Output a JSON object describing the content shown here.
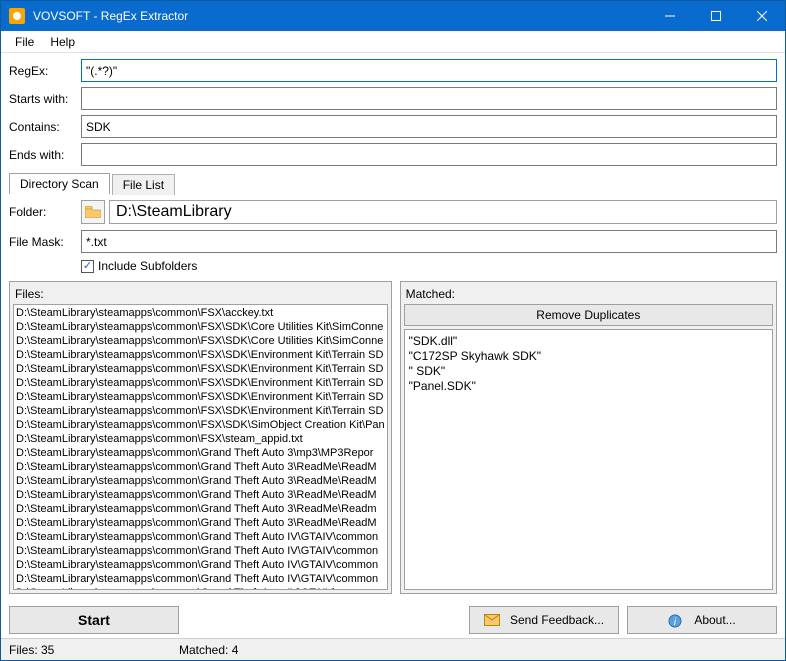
{
  "window": {
    "title": "VOVSOFT - RegEx Extractor"
  },
  "menu": {
    "file": "File",
    "help": "Help"
  },
  "fields": {
    "regex_label": "RegEx:",
    "regex_value": "\"(.*?)\"",
    "startswith_label": "Starts with:",
    "startswith_value": "",
    "contains_label": "Contains:",
    "contains_value": "SDK",
    "endswith_label": "Ends with:",
    "endswith_value": ""
  },
  "tabs": {
    "dir": "Directory Scan",
    "filelist": "File List"
  },
  "dirscan": {
    "folder_label": "Folder:",
    "folder_value": "D:\\SteamLibrary",
    "mask_label": "File Mask:",
    "mask_value": "*.txt",
    "include_sub": "Include Subfolders"
  },
  "panels": {
    "files_label": "Files:",
    "matched_label": "Matched:",
    "remove_dup": "Remove Duplicates"
  },
  "files": [
    "D:\\SteamLibrary\\steamapps\\common\\FSX\\acckey.txt",
    "D:\\SteamLibrary\\steamapps\\common\\FSX\\SDK\\Core Utilities Kit\\SimConne",
    "D:\\SteamLibrary\\steamapps\\common\\FSX\\SDK\\Core Utilities Kit\\SimConne",
    "D:\\SteamLibrary\\steamapps\\common\\FSX\\SDK\\Environment Kit\\Terrain SD",
    "D:\\SteamLibrary\\steamapps\\common\\FSX\\SDK\\Environment Kit\\Terrain SD",
    "D:\\SteamLibrary\\steamapps\\common\\FSX\\SDK\\Environment Kit\\Terrain SD",
    "D:\\SteamLibrary\\steamapps\\common\\FSX\\SDK\\Environment Kit\\Terrain SD",
    "D:\\SteamLibrary\\steamapps\\common\\FSX\\SDK\\Environment Kit\\Terrain SD",
    "D:\\SteamLibrary\\steamapps\\common\\FSX\\SDK\\SimObject Creation Kit\\Pan",
    "D:\\SteamLibrary\\steamapps\\common\\FSX\\steam_appid.txt",
    "D:\\SteamLibrary\\steamapps\\common\\Grand Theft Auto 3\\mp3\\MP3Repor",
    "D:\\SteamLibrary\\steamapps\\common\\Grand Theft Auto 3\\ReadMe\\ReadM",
    "D:\\SteamLibrary\\steamapps\\common\\Grand Theft Auto 3\\ReadMe\\ReadM",
    "D:\\SteamLibrary\\steamapps\\common\\Grand Theft Auto 3\\ReadMe\\ReadM",
    "D:\\SteamLibrary\\steamapps\\common\\Grand Theft Auto 3\\ReadMe\\Readm",
    "D:\\SteamLibrary\\steamapps\\common\\Grand Theft Auto 3\\ReadMe\\ReadM",
    "D:\\SteamLibrary\\steamapps\\common\\Grand Theft Auto IV\\GTAIV\\common",
    "D:\\SteamLibrary\\steamapps\\common\\Grand Theft Auto IV\\GTAIV\\common",
    "D:\\SteamLibrary\\steamapps\\common\\Grand Theft Auto IV\\GTAIV\\common",
    "D:\\SteamLibrary\\steamapps\\common\\Grand Theft Auto IV\\GTAIV\\common",
    "D:\\SteamLibrary\\steamapps\\common\\Grand Theft Auto IV\\GTAIV\\common"
  ],
  "matched": [
    "\"SDK.dll\"",
    "\"C172SP Skyhawk SDK\"",
    "\" SDK\"",
    "\"Panel.SDK\""
  ],
  "buttons": {
    "start": "Start",
    "feedback": "Send Feedback...",
    "about": "About..."
  },
  "status": {
    "files": "Files: 35",
    "matched": "Matched: 4"
  }
}
